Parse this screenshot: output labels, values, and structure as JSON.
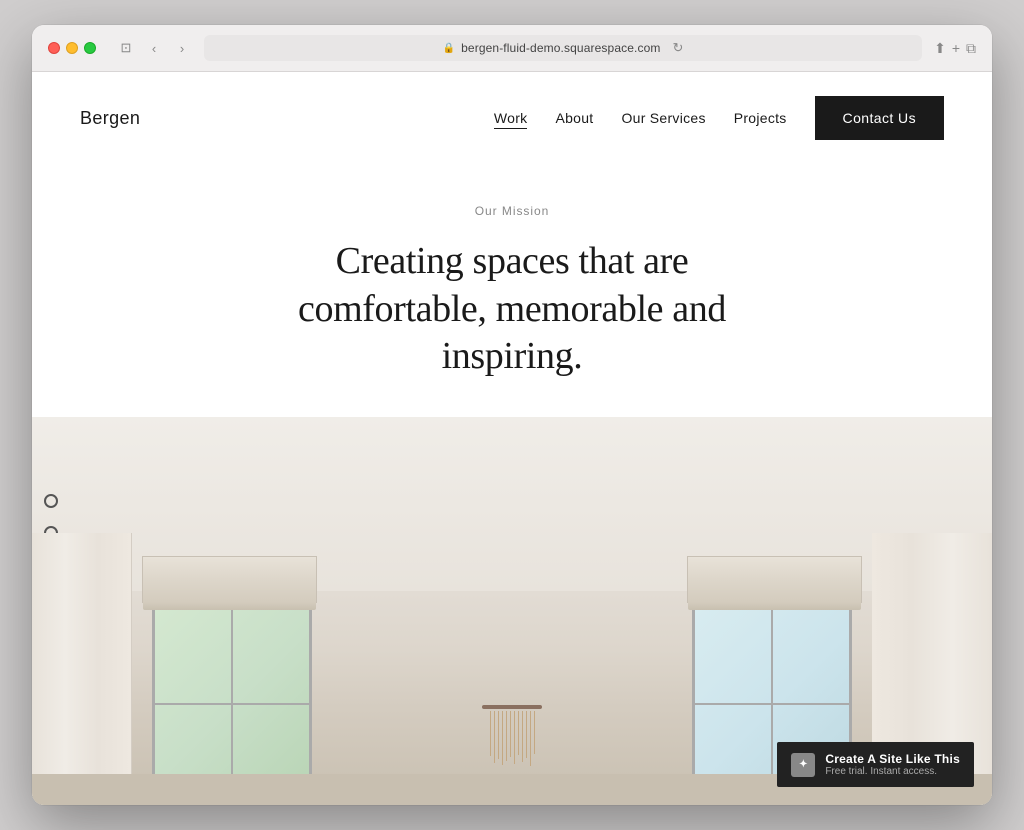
{
  "browser": {
    "url": "bergen-fluid-demo.squarespace.com",
    "back_label": "‹",
    "forward_label": "›",
    "reload_label": "↻",
    "share_label": "⬆",
    "add_tab_label": "+",
    "tab_label": "⊡"
  },
  "site": {
    "logo": "Bergen",
    "nav": {
      "links": [
        {
          "label": "Work",
          "active": true
        },
        {
          "label": "About",
          "active": false
        },
        {
          "label": "Our Services",
          "active": false
        },
        {
          "label": "Projects",
          "active": false
        }
      ],
      "cta_label": "Contact Us"
    },
    "hero": {
      "mission_label": "Our Mission",
      "headline_line1": "Creating spaces that are",
      "headline_line2": "comfortable, memorable and",
      "headline_line3": "inspiring."
    },
    "badge": {
      "title": "Create A Site Like This",
      "subtitle": "Free trial. Instant access."
    }
  }
}
